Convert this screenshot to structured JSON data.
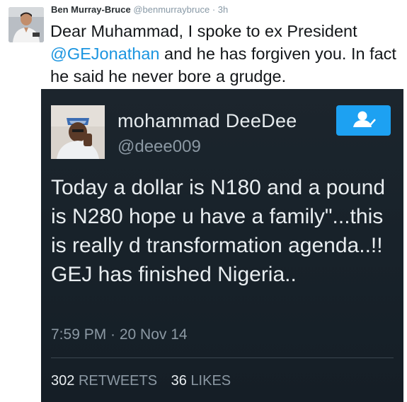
{
  "tweet": {
    "author_name": "Ben Murray-Bruce",
    "author_handle": "@benmurraybruce",
    "separator": "·",
    "time": "3h",
    "text_before": "Dear Muhammad, I spoke to ex President ",
    "mention": "@GEJonathan",
    "text_after": " and he has forgiven you. In fact he said he never bore a grudge."
  },
  "embedded_tweet": {
    "name": "mohammad  DeeDee",
    "handle": "@deee009",
    "body": "Today a dollar is N180 and a pound is N280 hope u have a family\"...this is really d transformation agenda..!! GEJ has finished Nigeria..",
    "timestamp": "7:59 PM · 20 Nov 14",
    "retweets_count": "302",
    "retweets_label": "RETWEETS",
    "likes_count": "36",
    "likes_label": "LIKES",
    "follow_icon": "person-check-icon"
  },
  "colors": {
    "link": "#1b95e0",
    "embed_background": "#1a232b",
    "follow_button": "#1da1f2"
  }
}
